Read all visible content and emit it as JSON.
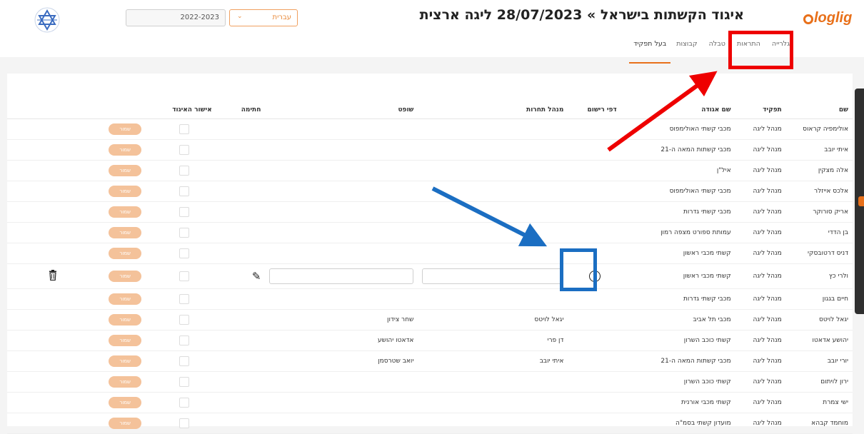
{
  "header": {
    "title": "איגוד הקשתות בישראל » 28/07/2023 ליגה ארצית",
    "brand": "loglig",
    "season_value": "2022-2023",
    "language_value": "עברית",
    "tabs": [
      {
        "label": "בעל תפקיד",
        "active": true
      },
      {
        "label": "קבוצות",
        "active": false
      },
      {
        "label": "טבלה",
        "active": false
      },
      {
        "label": "התראות",
        "active": false
      },
      {
        "label": "גלרייה",
        "active": false
      }
    ]
  },
  "table": {
    "headers": {
      "name": "שם",
      "role": "תפקיד",
      "club": "שם אגודה",
      "forms": "דפי רישום",
      "manager": "מנהל תחרות",
      "judge": "שופט",
      "signature": "חתימה",
      "approval": "אישור האיגוד"
    },
    "save_label": "שמור",
    "rows": [
      {
        "name": "אולימפיה קראוס",
        "role": "מנהל ליגה",
        "club": "מכבי קשתי האולימפוס",
        "manager": "",
        "judge": ""
      },
      {
        "name": "איתי יובב",
        "role": "מנהל ליגה",
        "club": "מכבי קשתות המאה ה-21",
        "manager": "",
        "judge": ""
      },
      {
        "name": "אלה מצקין",
        "role": "מנהל ליגה",
        "club": "איל\"ן",
        "manager": "",
        "judge": ""
      },
      {
        "name": "אלכס אייזלר",
        "role": "מנהל ליגה",
        "club": "מכבי קשתי האולימפוס",
        "manager": "",
        "judge": ""
      },
      {
        "name": "אריק סורוקר",
        "role": "מנהל ליגה",
        "club": "מכבי קשתי גדרות",
        "manager": "",
        "judge": ""
      },
      {
        "name": "בן הדדי",
        "role": "מנהל ליגה",
        "club": "עמותת ספורט מצפה רמון",
        "manager": "",
        "judge": ""
      },
      {
        "name": "דניס דרטובסקי",
        "role": "מנהל ליגה",
        "club": "קשתי מכבי ראשון",
        "manager": "",
        "judge": ""
      },
      {
        "name": "ולרי כץ",
        "role": "מנהל ליגה",
        "club": "קשתי מכבי ראשון",
        "manager": "",
        "judge": "",
        "editing": true
      },
      {
        "name": "חיים בגגון",
        "role": "מנהל ליגה",
        "club": "מכבי קשתי גדרות",
        "manager": "",
        "judge": ""
      },
      {
        "name": "יגאל לויטס",
        "role": "מנהל ליגה",
        "club": "מכבי תל אביב",
        "manager": "יגאל לויטס",
        "judge": "שחר צידון"
      },
      {
        "name": "יהושע אדאטו",
        "role": "מנהל ליגה",
        "club": "קשתי כוכב השרון",
        "manager": "דן פרי",
        "judge": "אדאטו יהושע"
      },
      {
        "name": "יורי יובב",
        "role": "מנהל ליגה",
        "club": "מכבי קשתות המאה ה-21",
        "manager": "איתי יובב",
        "judge": "יואב שטרסמן"
      },
      {
        "name": "ירון לויתום",
        "role": "מנהל ליגה",
        "club": "קשתי כוכב השרון",
        "manager": "",
        "judge": ""
      },
      {
        "name": "ישי צמרת",
        "role": "מנהל ליגה",
        "club": "קשתי מכבי אורנית",
        "manager": "",
        "judge": ""
      },
      {
        "name": "מוחמד קבהא",
        "role": "מנהל ליגה",
        "club": "מועדון קשתי בסמ\"ה",
        "manager": "",
        "judge": ""
      }
    ]
  },
  "annotations": {
    "red_color": "#ee0000",
    "blue_color": "#1b6ec2"
  },
  "colors": {
    "accent": "#e8701a",
    "save_button": "#f4c29a"
  }
}
